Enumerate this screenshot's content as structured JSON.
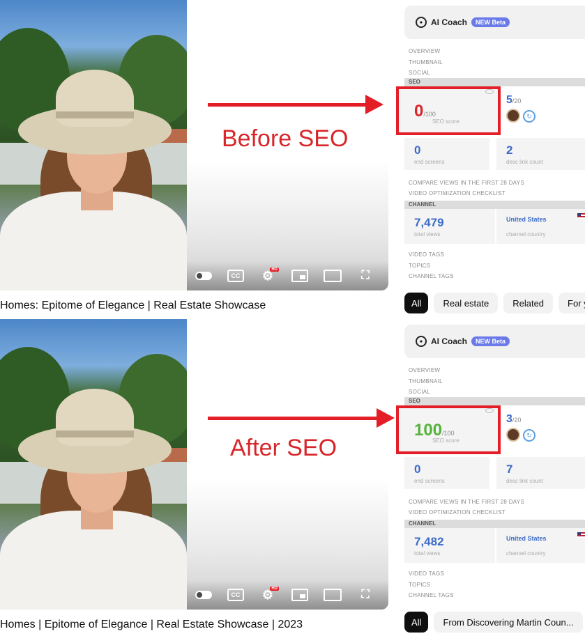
{
  "before": {
    "annotation": "Before SEO",
    "video_title": "Homes: Epitome of Elegance | Real Estate Showcase",
    "ai_coach": {
      "title": "AI Coach",
      "badge": "NEW Beta"
    },
    "nav": [
      "OVERVIEW",
      "THUMBNAIL",
      "SOCIAL"
    ],
    "seo_section": "SEO",
    "seo_score": {
      "value": "0",
      "max": "/100",
      "caption": "SEO score",
      "color": "#d7262a"
    },
    "tags_used": {
      "value": "5",
      "max": "/20"
    },
    "end_screens": {
      "value": "0",
      "caption": "end screens"
    },
    "desc_links": {
      "value": "2",
      "caption": "desc link count"
    },
    "compare_views": "COMPARE VIEWS IN THE FIRST 28 DAYS",
    "checklist": "VIDEO OPTIMIZATION CHECKLIST",
    "channel_section": "CHANNEL",
    "total_views": {
      "value": "7,479",
      "caption": "total views"
    },
    "channel_country": {
      "value": "United States",
      "caption": "channel country"
    },
    "tags_sections": [
      "VIDEO TAGS",
      "TOPICS",
      "CHANNEL TAGS"
    ],
    "chips": [
      "All",
      "Real estate",
      "Related",
      "For y"
    ]
  },
  "after": {
    "annotation": "After SEO",
    "video_title": "Homes | Epitome of Elegance | Real Estate Showcase | 2023",
    "ai_coach": {
      "title": "AI Coach",
      "badge": "NEW Beta"
    },
    "nav": [
      "OVERVIEW",
      "THUMBNAIL",
      "SOCIAL"
    ],
    "seo_section": "SEO",
    "seo_score": {
      "value": "100",
      "max": "/100",
      "caption": "SEO score",
      "color": "#55b33b"
    },
    "tags_used": {
      "value": "3",
      "max": "/20"
    },
    "end_screens": {
      "value": "0",
      "caption": "end screens"
    },
    "desc_links": {
      "value": "7",
      "caption": "desc link count"
    },
    "compare_views": "COMPARE VIEWS IN THE FIRST 28 DAYS",
    "checklist": "VIDEO OPTIMIZATION CHECKLIST",
    "channel_section": "CHANNEL",
    "total_views": {
      "value": "7,482",
      "caption": "total views"
    },
    "channel_country": {
      "value": "United States",
      "caption": "channel country"
    },
    "tags_sections": [
      "VIDEO TAGS",
      "TOPICS",
      "CHANNEL TAGS"
    ],
    "chips": [
      "All",
      "From Discovering Martin Coun..."
    ]
  },
  "player_controls": {
    "cc": "CC",
    "icons": [
      "autoplay-toggle-icon",
      "captions-icon",
      "settings-gear-icon",
      "miniplayer-icon",
      "theater-mode-icon",
      "fullscreen-icon"
    ],
    "hd_badge": "HD"
  },
  "colors": {
    "annotation_red": "#e41e26",
    "stat_blue": "#3b6bc8",
    "beta_purple": "#6a7ae8"
  }
}
